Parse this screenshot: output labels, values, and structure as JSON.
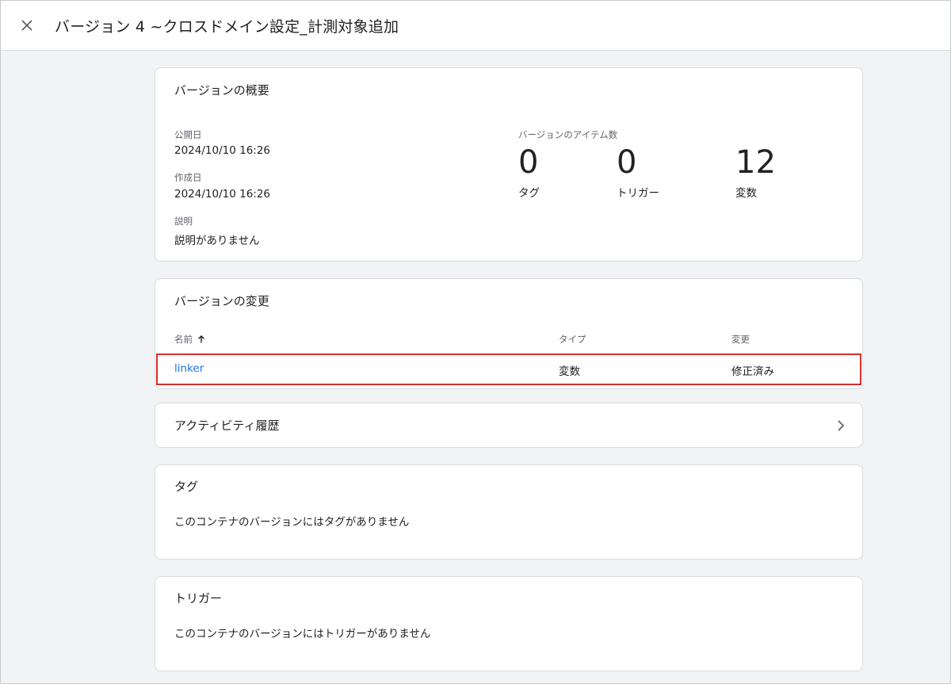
{
  "header": {
    "title": "バージョン 4 ~クロスドメイン設定_計測対象追加"
  },
  "overview": {
    "title": "バージョンの概要",
    "published_label": "公開日",
    "published_value": "2024/10/10 16:26",
    "created_label": "作成日",
    "created_value": "2024/10/10 16:26",
    "description_label": "説明",
    "description_value": "説明がありません",
    "counts_label": "バージョンのアイテム数",
    "counts": [
      {
        "value": "0",
        "label": "タグ"
      },
      {
        "value": "0",
        "label": "トリガー"
      },
      {
        "value": "12",
        "label": "変数"
      }
    ]
  },
  "changes": {
    "title": "バージョンの変更",
    "columns": [
      "名前",
      "タイプ",
      "変更"
    ],
    "rows": [
      {
        "name": "linker",
        "type": "変数",
        "change": "修正済み"
      }
    ],
    "highlight_color": "#d32f2f"
  },
  "activity": {
    "title": "アクティビティ履歴"
  },
  "tags": {
    "title": "タグ",
    "empty": "このコンテナのバージョンにはタグがありません"
  },
  "triggers": {
    "title": "トリガー",
    "empty": "このコンテナのバージョンにはトリガーがありません"
  },
  "icons": {
    "close": "close-icon",
    "sort": "arrow-up-icon",
    "chevron": "chevron-right-icon"
  },
  "colors": {
    "link": "#1a73e8",
    "background": "#f1f3f4"
  }
}
